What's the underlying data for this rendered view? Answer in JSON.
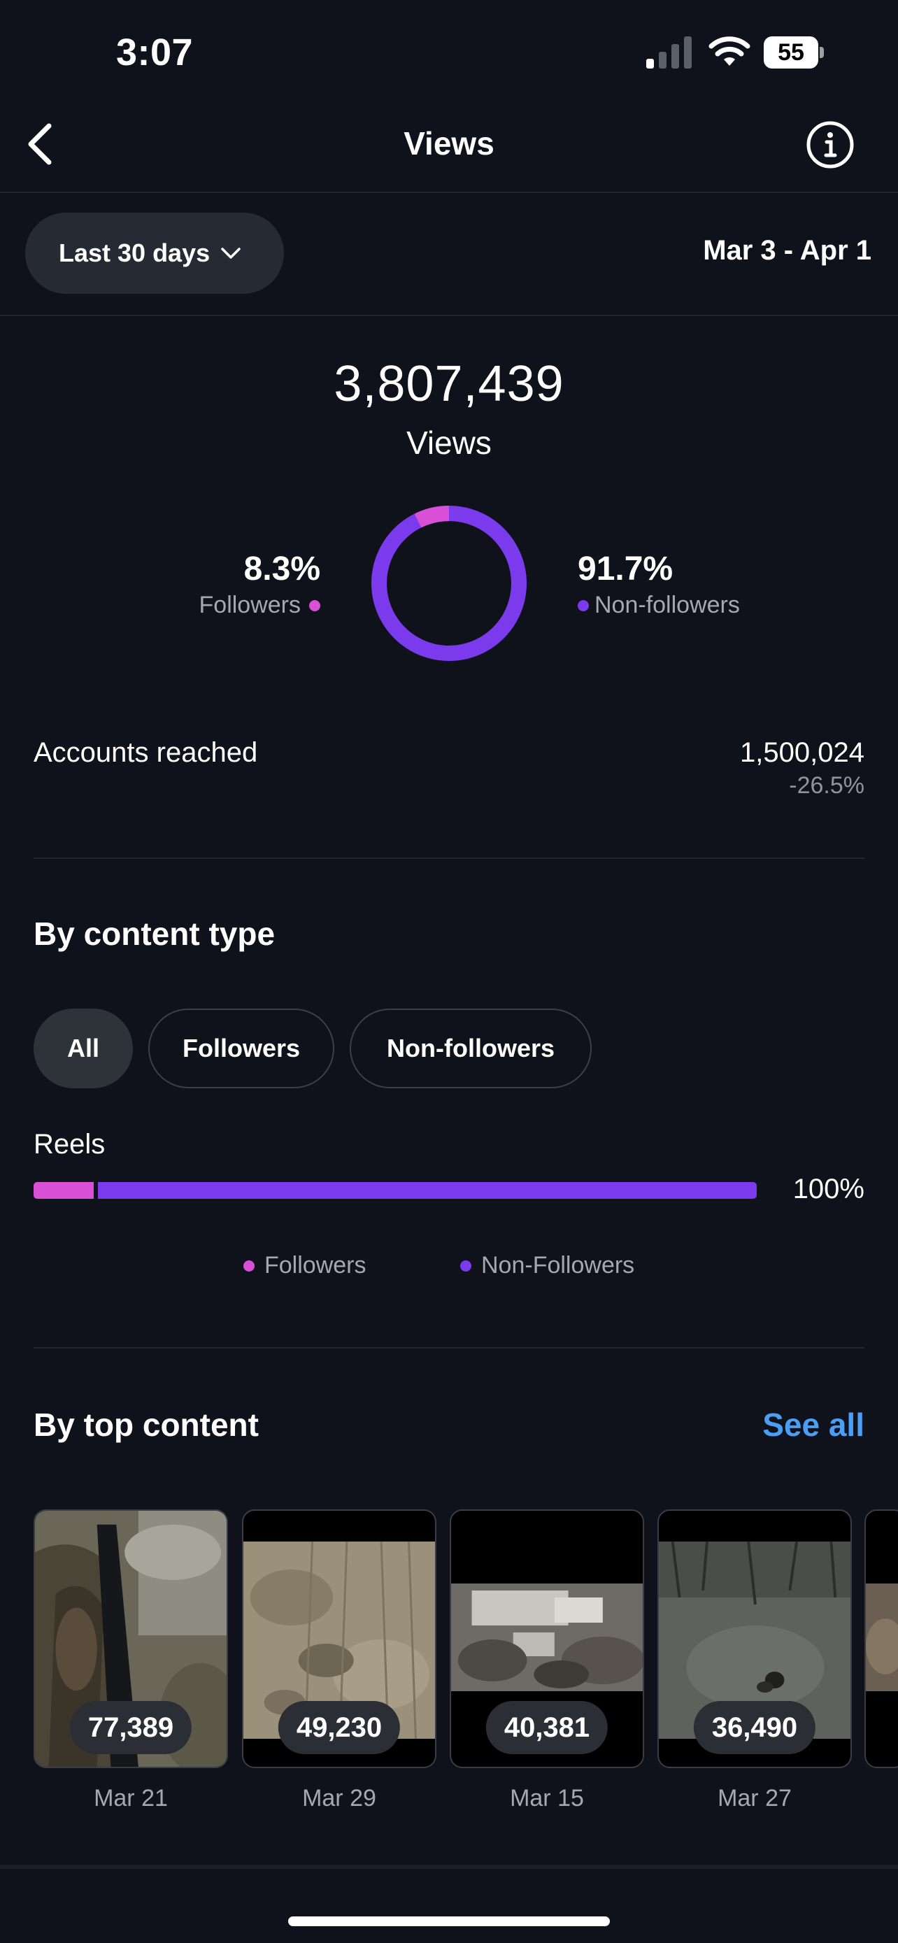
{
  "status_bar": {
    "time": "3:07",
    "battery": "55"
  },
  "nav": {
    "title": "Views"
  },
  "filter": {
    "range_label": "Last 30 days",
    "date_range": "Mar 3 - Apr 1"
  },
  "summary": {
    "total": "3,807,439",
    "label": "Views",
    "followers_pct": "8.3%",
    "followers_label": "Followers",
    "non_followers_pct": "91.7%",
    "non_followers_label": "Non-followers",
    "followers_fraction": 0.083
  },
  "accounts": {
    "label": "Accounts reached",
    "value": "1,500,024",
    "change": "-26.5%"
  },
  "content_type": {
    "title": "By content type",
    "chips": [
      "All",
      "Followers",
      "Non-followers"
    ],
    "reels_label": "Reels",
    "reels_pct": "100%",
    "followers_fraction": 0.083,
    "legend": [
      "Followers",
      "Non-Followers"
    ]
  },
  "top_content": {
    "title": "By top content",
    "see_all": "See all",
    "items": [
      {
        "views": "77,389",
        "date": "Mar 21"
      },
      {
        "views": "49,230",
        "date": "Mar 29"
      },
      {
        "views": "40,381",
        "date": "Mar 15"
      },
      {
        "views": "36,490",
        "date": "Mar 27"
      }
    ]
  },
  "colors": {
    "followers": "#d94fd6",
    "non_followers": "#7c3aed",
    "link": "#4a9ff5",
    "background": "#0f121a"
  },
  "icons": [
    "signal-icon",
    "wifi-icon",
    "battery-icon",
    "back-chevron-icon",
    "info-icon",
    "chevron-down-icon"
  ]
}
